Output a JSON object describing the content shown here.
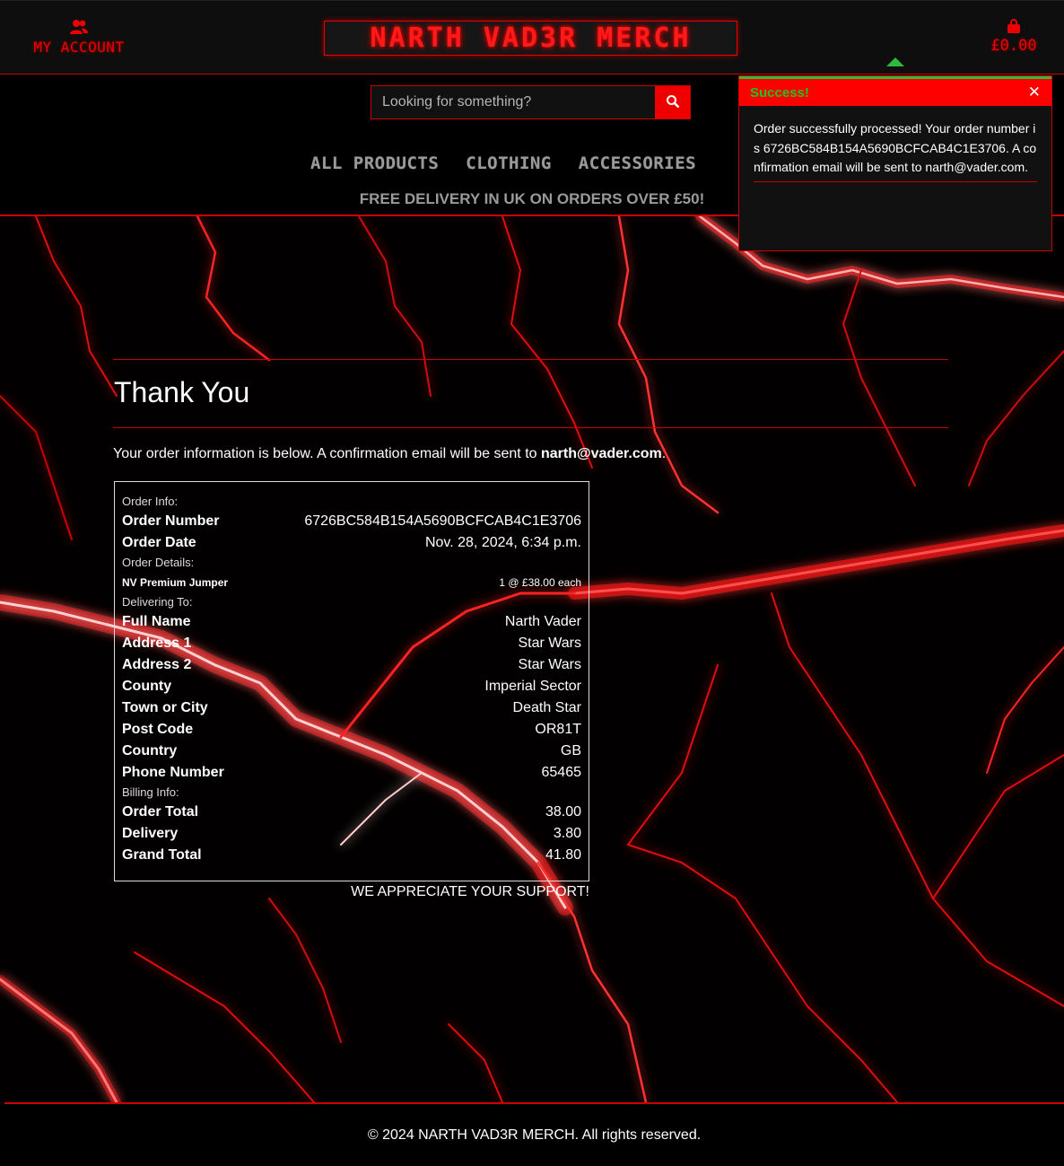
{
  "header": {
    "account_label": "MY ACCOUNT",
    "logo_text": "NARTH VAD3R MERCH",
    "cart_total": "£0.00"
  },
  "search": {
    "placeholder": "Looking for something?"
  },
  "nav": {
    "items": [
      "ALL PRODUCTS",
      "CLOTHING",
      "ACCESSORIES"
    ]
  },
  "banner": "FREE DELIVERY IN UK ON ORDERS OVER £50!",
  "toast": {
    "title": "Success!",
    "message": "Order successfully processed! Your order number is 6726BC584B154A5690BCFCAB4C1E3706. A confirmation email will be sent to narth@vader.com."
  },
  "page": {
    "title": "Thank You",
    "intro_prefix": "Your order information is below. A confirmation email will be sent to ",
    "intro_email": "narth@vader.com",
    "intro_suffix": "."
  },
  "order": {
    "info_heading": "Order Info:",
    "number_label": "Order Number",
    "number": "6726BC584B154A5690BCFCAB4C1E3706",
    "date_label": "Order Date",
    "date": "Nov. 28, 2024, 6:34 p.m.",
    "details_heading": "Order Details:",
    "item_name": "NV Premium Jumper",
    "item_qty": "1 @ £38.00 each",
    "delivering_heading": "Delivering To:",
    "address_rows": [
      {
        "k": "Full Name",
        "v": "Narth Vader"
      },
      {
        "k": "Address 1",
        "v": "Star Wars"
      },
      {
        "k": "Address 2",
        "v": "Star Wars"
      },
      {
        "k": "County",
        "v": "Imperial Sector"
      },
      {
        "k": "Town or City",
        "v": "Death Star"
      },
      {
        "k": "Post Code",
        "v": "OR81T"
      },
      {
        "k": "Country",
        "v": "GB"
      },
      {
        "k": "Phone Number",
        "v": "65465"
      }
    ],
    "billing_heading": "Billing Info:",
    "billing_rows": [
      {
        "k": "Order Total",
        "v": "38.00"
      },
      {
        "k": "Delivery",
        "v": "3.80"
      },
      {
        "k": "Grand Total",
        "v": "41.80"
      }
    ]
  },
  "thanks": "WE APPRECIATE YOUR SUPPORT!",
  "footer": "© 2024 NARTH VAD3R MERCH. All rights reserved.",
  "colors": {
    "accent": "#e00000",
    "success": "#2dbb3c",
    "background": "#000000"
  }
}
